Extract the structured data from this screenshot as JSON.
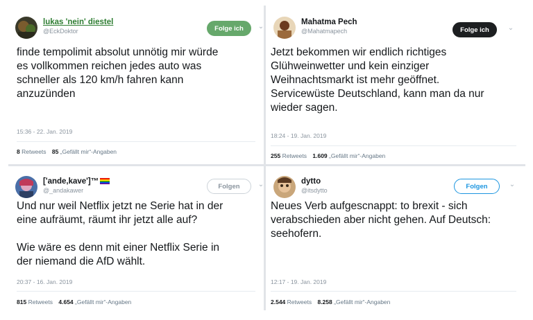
{
  "tweets": [
    {
      "display_name": "lukas 'nein' diestel",
      "handle": "@EckDoktor",
      "follow_label": "Folge ich",
      "text": "finde tempolimit absolut unnötig mir würde\nes vollkommen reichen jedes auto was\nschneller als 120 km/h fahren kann\nanzuzünden",
      "timestamp": "15:36 - 22. Jan. 2019",
      "retweets": "8",
      "retweets_label": "Retweets",
      "likes": "85",
      "likes_label": "„Gefällt mir“-Angaben"
    },
    {
      "display_name": "Mahatma Pech",
      "handle": "@Mahatmapech",
      "follow_label": "Folge ich",
      "text": "Jetzt bekommen wir endlich richtiges\nGlühweinwetter und kein einziger\nWeihnachtsmarkt ist mehr geöffnet.\nServicewüste Deutschland, kann man da nur\nwieder sagen.",
      "timestamp": "18:24 - 19. Jan. 2019",
      "retweets": "255",
      "retweets_label": "Retweets",
      "likes": "1.609",
      "likes_label": "„Gefällt mir“-Angaben"
    },
    {
      "display_name": "['ande,kave']™",
      "handle": "@_andakawer",
      "follow_label": "Folgen",
      "text": "Und nur weil Netflix jetzt ne Serie hat in der\neine aufräumt, räumt ihr jetzt alle auf?\n\nWie wäre es denn mit einer Netflix Serie in\nder niemand die AfD wählt.",
      "timestamp": "20:37 - 16. Jan. 2019",
      "retweets": "815",
      "retweets_label": "Retweets",
      "likes": "4.654",
      "likes_label": "„Gefällt mir“-Angaben"
    },
    {
      "display_name": "dytto",
      "handle": "@itsdytto",
      "follow_label": "Folgen",
      "text": "Neues Verb aufgescnappt: to brexit - sich\nverabschieden aber nicht gehen. Auf Deutsch:\nseehofern.",
      "timestamp": "12:17 - 19. Jan. 2019",
      "retweets": "2.544",
      "retweets_label": "Retweets",
      "likes": "8.258",
      "likes_label": "„Gefällt mir“-Angaben"
    }
  ],
  "chevron_icon": "chevron-down-icon",
  "colors": {
    "follow_green": "#66a86b",
    "follow_dark": "#1d1f21",
    "follow_blue": "#1b95e0",
    "text": "#14171a",
    "muted": "#8a949e"
  }
}
